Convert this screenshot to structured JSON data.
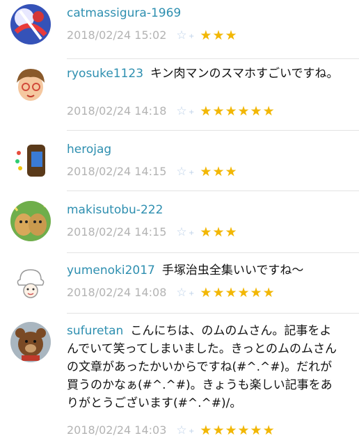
{
  "comments": [
    {
      "user": "catmassigura-1969",
      "message": "",
      "timestamp": "2018/02/24 15:02",
      "stars": "★★★",
      "star_count": 3,
      "avatar": "avatar"
    },
    {
      "user": "ryosuke1123",
      "message": "キン肉マンのスマホすごいですね。",
      "timestamp": "2018/02/24 14:18",
      "stars": "★★★★★★",
      "star_count": 6,
      "avatar": "avatar"
    },
    {
      "user": "herojag",
      "message": "",
      "timestamp": "2018/02/24 14:15",
      "stars": "★★★",
      "star_count": 3,
      "avatar": "avatar"
    },
    {
      "user": "makisutobu-222",
      "message": "",
      "timestamp": "2018/02/24 14:15",
      "stars": "★★★",
      "star_count": 3,
      "avatar": "avatar"
    },
    {
      "user": "yumenoki2017",
      "message": "手塚治虫全集いいですね〜",
      "timestamp": "2018/02/24 14:08",
      "stars": "★★★★★★",
      "star_count": 6,
      "avatar": "avatar"
    },
    {
      "user": "sufuretan",
      "message": "こんにちは、のムのムさん。記事をよんでいて笑ってしまいました。きっとのムのムさんの文章があったかいからですね(#^.^#)。だれが買うのかなぁ(#^.^#)。きょうも楽しい記事をありがとうございます(#^.^#)/。",
      "timestamp": "2018/02/24 14:03",
      "stars": "★★★★★★",
      "star_count": 6,
      "avatar": "avatar"
    }
  ],
  "add_star_icon": "add-star-icon",
  "colors": {
    "username": "#2e8fb0",
    "timestamp": "#b3b3b3",
    "star": "#f2b705",
    "add_star": "#bcd0e8"
  }
}
